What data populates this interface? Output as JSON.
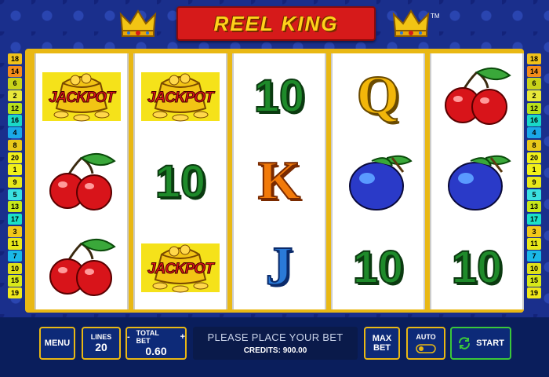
{
  "title": "REEL KING",
  "trademark": "TM",
  "colors": {
    "accent": "#e9b814",
    "start": "#3ac83a",
    "logo_red": "#d61a1a",
    "logo_gold": "#ffd21a"
  },
  "left_lines": [
    "18",
    "14",
    "6",
    "2",
    "12",
    "16",
    "4",
    "8",
    "20",
    "1",
    "9",
    "5",
    "13",
    "17",
    "3",
    "11",
    "7",
    "10",
    "15",
    "19"
  ],
  "right_lines": [
    "18",
    "14",
    "6",
    "2",
    "12",
    "16",
    "4",
    "8",
    "20",
    "1",
    "9",
    "5",
    "13",
    "17",
    "3",
    "11",
    "7",
    "10",
    "15",
    "19"
  ],
  "line_colors": [
    "#f0c21a",
    "#f58c1a",
    "#c8d21a",
    "#e8e83a",
    "#b8e01a",
    "#1ad8c8",
    "#1aa8e8",
    "#e8c81a",
    "#f0f01a",
    "#f0f01a",
    "#e8e81a",
    "#3ae0e0",
    "#c8e81a",
    "#1ae0c8",
    "#f0c81a",
    "#e8e81a",
    "#1ab8e8",
    "#e0e01a",
    "#d8e81a",
    "#f0e81a"
  ],
  "reels": [
    [
      "jackpot",
      "cherry",
      "cherry"
    ],
    [
      "jackpot",
      "10",
      "jackpot"
    ],
    [
      "10",
      "K",
      "J"
    ],
    [
      "Q",
      "plum",
      "10"
    ],
    [
      "cherry",
      "plum",
      "10"
    ]
  ],
  "jackpot_word": "JACKPOT",
  "controls": {
    "menu": "MENU",
    "lines_label": "LINES",
    "lines_value": "20",
    "total_bet_minus": "-",
    "total_bet_label": "TOTAL BET",
    "total_bet_plus": "+",
    "total_bet_value": "0.60",
    "message": "PLEASE PLACE YOUR BET",
    "credits": "CREDITS: 900.00",
    "max_bet_1": "MAX",
    "max_bet_2": "BET",
    "auto_label": "AUTO",
    "start": "START"
  }
}
